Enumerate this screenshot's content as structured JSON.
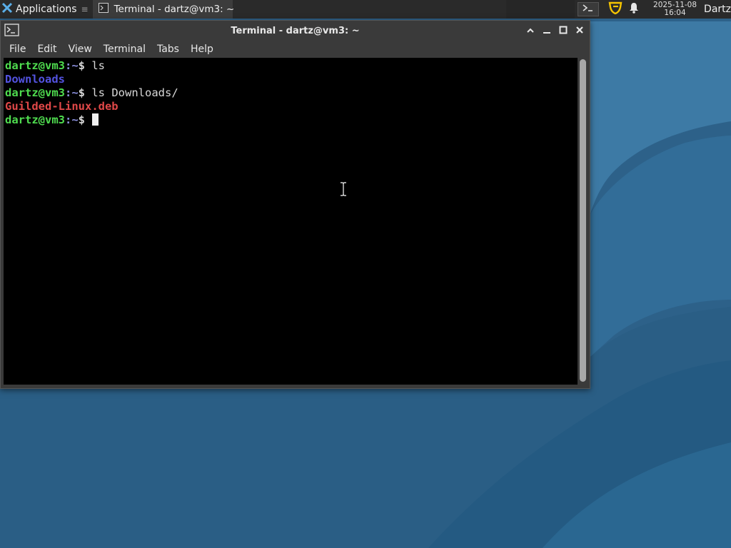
{
  "panel": {
    "applications_label": "Applications",
    "applications_sep": "≡",
    "task_label": "Terminal - dartz@vm3: ~",
    "clock_date": "2025-11-08",
    "clock_time": "16:04",
    "user_label": "Dartz",
    "icons": [
      "applications-icon",
      "terminal-icon",
      "guilded-icon",
      "bell-icon"
    ]
  },
  "window": {
    "title": "Terminal - dartz@vm3: ~",
    "menu": [
      "File",
      "Edit",
      "View",
      "Terminal",
      "Tabs",
      "Help"
    ]
  },
  "terminal": {
    "lines": [
      {
        "user": "dartz@vm3",
        "path": ":~",
        "dollar": "$ ",
        "cmd": "ls"
      },
      {
        "output": "Downloads",
        "kind": "dir"
      },
      {
        "user": "dartz@vm3",
        "path": ":~",
        "dollar": "$ ",
        "cmd": "ls Downloads/"
      },
      {
        "output": "Guilded-Linux.deb",
        "kind": "deb"
      },
      {
        "user": "dartz@vm3",
        "path": ":~",
        "dollar": "$ ",
        "cmd": ""
      }
    ]
  },
  "colors": {
    "prompt_user": "#4fdc4f",
    "directory": "#5353e0",
    "deb_file": "#e04848",
    "desktop": "#2b5f86"
  }
}
